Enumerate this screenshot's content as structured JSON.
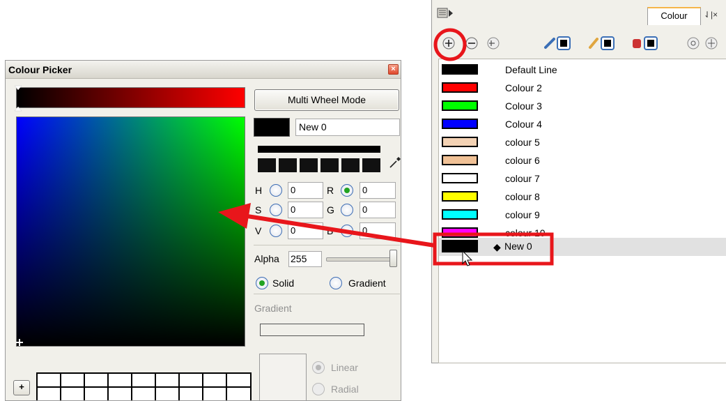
{
  "picker": {
    "title": "Colour Picker",
    "close_glyph": "×",
    "multi_wheel_label": "Multi Wheel Mode",
    "color_name": "New 0",
    "h_label": "H",
    "h_value": "0",
    "s_label": "S",
    "s_value": "0",
    "v_label": "V",
    "v_value": "0",
    "r_label": "R",
    "r_value": "0",
    "g_label": "G",
    "g_value": "0",
    "b_label": "B",
    "b_value": "0",
    "alpha_label": "Alpha",
    "alpha_value": "255",
    "solid_label": "Solid",
    "gradient_label": "Gradient",
    "gradient_section_label": "Gradient",
    "linear_label": "Linear",
    "radial_label": "Radial",
    "add_swatch_label": "+",
    "colors": {
      "hue_start": "#000000",
      "hue_end": "#ff0000",
      "current": "#000000",
      "selected_radio": "#21a321"
    }
  },
  "panel": {
    "tab_label": "Colour",
    "tab_extra": "⇃|×",
    "toolbar_icons": [
      "add-color-icon",
      "remove-color-icon",
      "texture-icon",
      "line-color-icon",
      "fill-color-icon",
      "paint-color-icon",
      "link-icon",
      "move-icon"
    ],
    "colors": [
      {
        "name": "Default Line",
        "color": "#000000"
      },
      {
        "name": "Colour 2",
        "color": "#ff0000"
      },
      {
        "name": "Colour 3",
        "color": "#00ff00"
      },
      {
        "name": "Colour 4",
        "color": "#0000ff"
      },
      {
        "name": "colour 5",
        "color": "#f3d2b4"
      },
      {
        "name": "colour 6",
        "color": "#f0c196"
      },
      {
        "name": "colour 7",
        "color": "#ffffff"
      },
      {
        "name": "colour 8",
        "color": "#ffff00"
      },
      {
        "name": "colour 9",
        "color": "#00ffff"
      },
      {
        "name": "colour 10",
        "color": "#ff00ff"
      }
    ],
    "new_color": {
      "name": "New 0",
      "bullet": "◆",
      "color": "#000000"
    }
  },
  "annotation_color": "#e8161b"
}
